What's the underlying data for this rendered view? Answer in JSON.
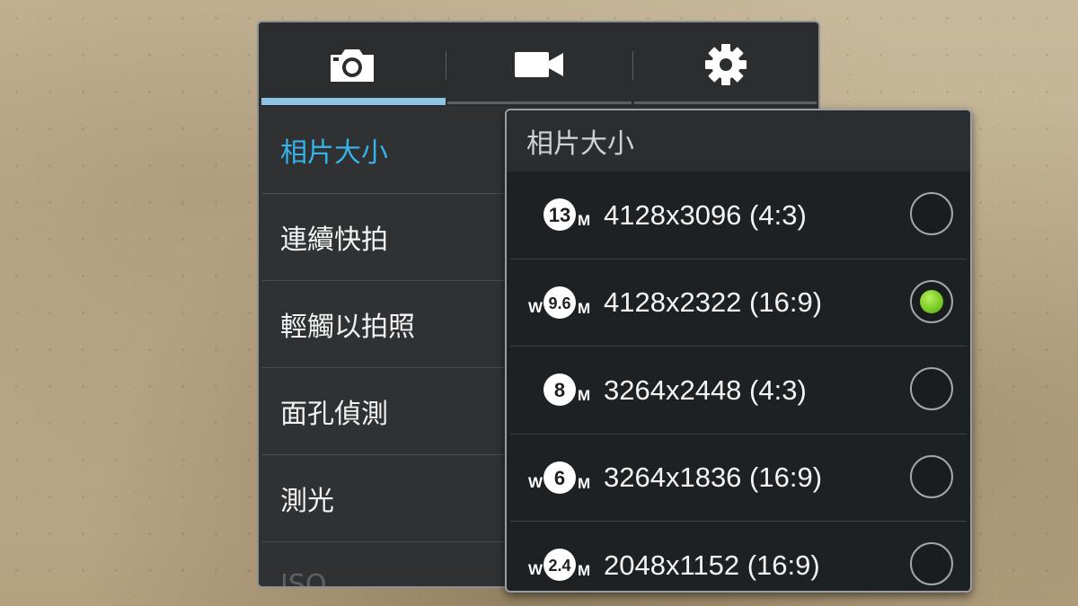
{
  "tabs": [
    {
      "icon": "camera-icon",
      "active": true
    },
    {
      "icon": "video-camera-icon",
      "active": false
    },
    {
      "icon": "gear-icon",
      "active": false
    }
  ],
  "colors": {
    "accent": "#36b4ea",
    "tab_indicator": "#8fc3e6",
    "selected_radio": "#6cc21a"
  },
  "menu": {
    "items": [
      {
        "label": "相片大小",
        "active": true
      },
      {
        "label": "連續快拍",
        "active": false
      },
      {
        "label": "輕觸以拍照",
        "active": false
      },
      {
        "label": "面孔偵測",
        "active": false
      },
      {
        "label": "測光",
        "active": false
      },
      {
        "label": "ISO",
        "active": false
      }
    ]
  },
  "popup": {
    "title": "相片大小",
    "options": [
      {
        "badge_prefix": "",
        "badge_value": "13",
        "badge_unit": "M",
        "label": "4128x3096 (4:3)",
        "selected": false
      },
      {
        "badge_prefix": "W",
        "badge_value": "9.6",
        "badge_unit": "M",
        "label": "4128x2322 (16:9)",
        "selected": true
      },
      {
        "badge_prefix": "",
        "badge_value": "8",
        "badge_unit": "M",
        "label": "3264x2448 (4:3)",
        "selected": false
      },
      {
        "badge_prefix": "W",
        "badge_value": "6",
        "badge_unit": "M",
        "label": "3264x1836 (16:9)",
        "selected": false
      },
      {
        "badge_prefix": "W",
        "badge_value": "2.4",
        "badge_unit": "M",
        "label": "2048x1152 (16:9)",
        "selected": false
      }
    ]
  }
}
